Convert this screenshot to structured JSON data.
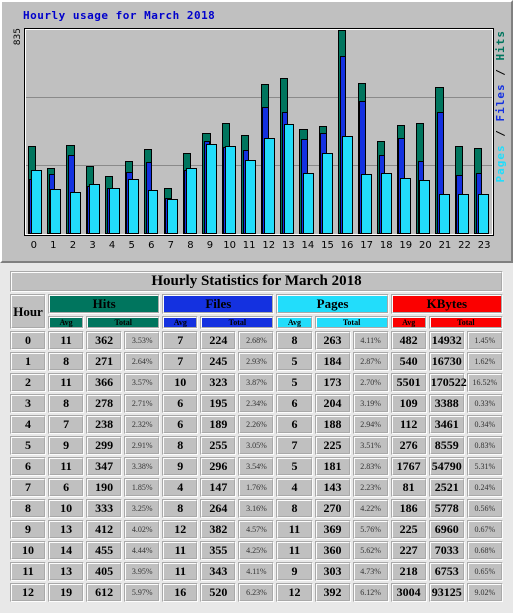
{
  "chart": {
    "title": "Hourly usage for March 2018",
    "y_max_label": "835",
    "y_axis_right": [
      {
        "text": "Pages",
        "color": "#22ddfb"
      },
      {
        "text": " / ",
        "color": "#000000"
      },
      {
        "text": "Files",
        "color": "#1431e0"
      },
      {
        "text": " / ",
        "color": "#000000"
      },
      {
        "text": "Hits",
        "color": "#00755e"
      }
    ]
  },
  "chart_data": {
    "type": "bar",
    "title": "Hourly usage for March 2018",
    "xlabel": "",
    "ylabel": "Pages / Files / Hits",
    "ylim": [
      0,
      835
    ],
    "grid": true,
    "legend": "right-rotated-axis-label",
    "categories": [
      "0",
      "1",
      "2",
      "3",
      "4",
      "5",
      "6",
      "7",
      "8",
      "9",
      "10",
      "11",
      "12",
      "13",
      "14",
      "15",
      "16",
      "17",
      "18",
      "19",
      "20",
      "21",
      "22",
      "23"
    ],
    "series": [
      {
        "name": "Hits",
        "color": "#00755e",
        "values": [
          362,
          271,
          366,
          278,
          238,
          299,
          347,
          190,
          333,
          412,
          455,
          405,
          612,
          640,
          430,
          442,
          835,
          620,
          380,
          448,
          455,
          600,
          360,
          352
        ]
      },
      {
        "name": "Files",
        "color": "#1431e0",
        "values": [
          224,
          245,
          323,
          195,
          189,
          255,
          296,
          147,
          264,
          382,
          355,
          343,
          520,
          498,
          390,
          415,
          730,
          545,
          325,
          395,
          300,
          500,
          240,
          250
        ]
      },
      {
        "name": "Pages",
        "color": "#22ddfb",
        "values": [
          263,
          184,
          173,
          204,
          188,
          225,
          181,
          143,
          270,
          369,
          360,
          303,
          392,
          450,
          250,
          330,
          400,
          245,
          250,
          230,
          220,
          165,
          165,
          165
        ]
      }
    ]
  },
  "table": {
    "title": "Hourly Statistics for March 2018",
    "hour_header": "Hour",
    "groups": [
      {
        "label": "Hits",
        "color": "#00755e"
      },
      {
        "label": "Files",
        "color": "#1431e0"
      },
      {
        "label": "Pages",
        "color": "#22ddfb"
      },
      {
        "label": "KBytes",
        "color": "#fb0000"
      }
    ],
    "subheaders": [
      "Avg",
      "Total"
    ],
    "rows": [
      {
        "hour": "0",
        "hits_avg": "11",
        "hits_total": "362",
        "hits_pct": "3.53%",
        "files_avg": "7",
        "files_total": "224",
        "files_pct": "2.68%",
        "pages_avg": "8",
        "pages_total": "263",
        "pages_pct": "4.11%",
        "kb_avg": "482",
        "kb_total": "14932",
        "kb_pct": "1.45%"
      },
      {
        "hour": "1",
        "hits_avg": "8",
        "hits_total": "271",
        "hits_pct": "2.64%",
        "files_avg": "7",
        "files_total": "245",
        "files_pct": "2.93%",
        "pages_avg": "5",
        "pages_total": "184",
        "pages_pct": "2.87%",
        "kb_avg": "540",
        "kb_total": "16730",
        "kb_pct": "1.62%"
      },
      {
        "hour": "2",
        "hits_avg": "11",
        "hits_total": "366",
        "hits_pct": "3.57%",
        "files_avg": "10",
        "files_total": "323",
        "files_pct": "3.87%",
        "pages_avg": "5",
        "pages_total": "173",
        "pages_pct": "2.70%",
        "kb_avg": "5501",
        "kb_total": "170522",
        "kb_pct": "16.52%"
      },
      {
        "hour": "3",
        "hits_avg": "8",
        "hits_total": "278",
        "hits_pct": "2.71%",
        "files_avg": "6",
        "files_total": "195",
        "files_pct": "2.34%",
        "pages_avg": "6",
        "pages_total": "204",
        "pages_pct": "3.19%",
        "kb_avg": "109",
        "kb_total": "3388",
        "kb_pct": "0.33%"
      },
      {
        "hour": "4",
        "hits_avg": "7",
        "hits_total": "238",
        "hits_pct": "2.32%",
        "files_avg": "6",
        "files_total": "189",
        "files_pct": "2.26%",
        "pages_avg": "6",
        "pages_total": "188",
        "pages_pct": "2.94%",
        "kb_avg": "112",
        "kb_total": "3461",
        "kb_pct": "0.34%"
      },
      {
        "hour": "5",
        "hits_avg": "9",
        "hits_total": "299",
        "hits_pct": "2.91%",
        "files_avg": "8",
        "files_total": "255",
        "files_pct": "3.05%",
        "pages_avg": "7",
        "pages_total": "225",
        "pages_pct": "3.51%",
        "kb_avg": "276",
        "kb_total": "8559",
        "kb_pct": "0.83%"
      },
      {
        "hour": "6",
        "hits_avg": "11",
        "hits_total": "347",
        "hits_pct": "3.38%",
        "files_avg": "9",
        "files_total": "296",
        "files_pct": "3.54%",
        "pages_avg": "5",
        "pages_total": "181",
        "pages_pct": "2.83%",
        "kb_avg": "1767",
        "kb_total": "54790",
        "kb_pct": "5.31%"
      },
      {
        "hour": "7",
        "hits_avg": "6",
        "hits_total": "190",
        "hits_pct": "1.85%",
        "files_avg": "4",
        "files_total": "147",
        "files_pct": "1.76%",
        "pages_avg": "4",
        "pages_total": "143",
        "pages_pct": "2.23%",
        "kb_avg": "81",
        "kb_total": "2521",
        "kb_pct": "0.24%"
      },
      {
        "hour": "8",
        "hits_avg": "10",
        "hits_total": "333",
        "hits_pct": "3.25%",
        "files_avg": "8",
        "files_total": "264",
        "files_pct": "3.16%",
        "pages_avg": "8",
        "pages_total": "270",
        "pages_pct": "4.22%",
        "kb_avg": "186",
        "kb_total": "5778",
        "kb_pct": "0.56%"
      },
      {
        "hour": "9",
        "hits_avg": "13",
        "hits_total": "412",
        "hits_pct": "4.02%",
        "files_avg": "12",
        "files_total": "382",
        "files_pct": "4.57%",
        "pages_avg": "11",
        "pages_total": "369",
        "pages_pct": "5.76%",
        "kb_avg": "225",
        "kb_total": "6960",
        "kb_pct": "0.67%"
      },
      {
        "hour": "10",
        "hits_avg": "14",
        "hits_total": "455",
        "hits_pct": "4.44%",
        "files_avg": "11",
        "files_total": "355",
        "files_pct": "4.25%",
        "pages_avg": "11",
        "pages_total": "360",
        "pages_pct": "5.62%",
        "kb_avg": "227",
        "kb_total": "7033",
        "kb_pct": "0.68%"
      },
      {
        "hour": "11",
        "hits_avg": "13",
        "hits_total": "405",
        "hits_pct": "3.95%",
        "files_avg": "11",
        "files_total": "343",
        "files_pct": "4.11%",
        "pages_avg": "9",
        "pages_total": "303",
        "pages_pct": "4.73%",
        "kb_avg": "218",
        "kb_total": "6753",
        "kb_pct": "0.65%"
      },
      {
        "hour": "12",
        "hits_avg": "19",
        "hits_total": "612",
        "hits_pct": "5.97%",
        "files_avg": "16",
        "files_total": "520",
        "files_pct": "6.23%",
        "pages_avg": "12",
        "pages_total": "392",
        "pages_pct": "6.12%",
        "kb_avg": "3004",
        "kb_total": "93125",
        "kb_pct": "9.02%"
      }
    ]
  }
}
